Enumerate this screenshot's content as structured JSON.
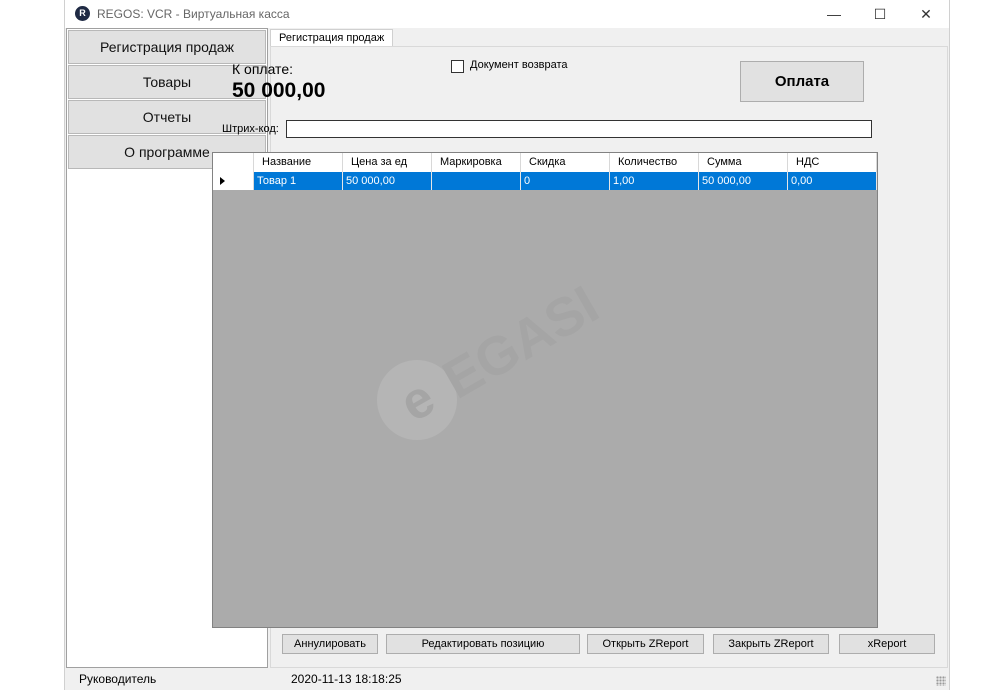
{
  "window": {
    "title": "REGOS: VCR - Виртуальная касса",
    "controls": {
      "minimize": "—",
      "maximize": "☐",
      "close": "✕"
    }
  },
  "sidebar": {
    "items": [
      {
        "label": "Регистрация продаж"
      },
      {
        "label": "Товары"
      },
      {
        "label": "Отчеты"
      },
      {
        "label": "О программе"
      }
    ]
  },
  "tab": {
    "label": "Регистрация продаж"
  },
  "payment": {
    "due_label": "К оплате:",
    "due_amount": "50 000,00",
    "return_doc_label": "Документ возврата",
    "return_doc_checked": false,
    "pay_button": "Оплата"
  },
  "barcode": {
    "label": "Штрих-код:",
    "value": ""
  },
  "table": {
    "columns": [
      "Название",
      "Цена за ед",
      "Маркировка",
      "Скидка",
      "Количество",
      "Сумма",
      "НДС"
    ],
    "rows": [
      [
        "Товар 1",
        "50 000,00",
        "",
        "0",
        "1,00",
        "50 000,00",
        "0,00"
      ]
    ],
    "selected_row": 0
  },
  "actions": {
    "cancel": "Аннулировать",
    "edit_position": "Редактировать позицию",
    "open_zreport": "Открыть ZReport",
    "close_zreport": "Закрыть ZReport",
    "xreport": "xReport"
  },
  "statusbar": {
    "role": "Руководитель",
    "datetime": "2020-11-13 18:18:25"
  },
  "watermark": {
    "text": "EGASI"
  },
  "colors": {
    "selection": "#0078d7",
    "grid_background": "#ababab",
    "window_background": "#f0f0f0"
  }
}
